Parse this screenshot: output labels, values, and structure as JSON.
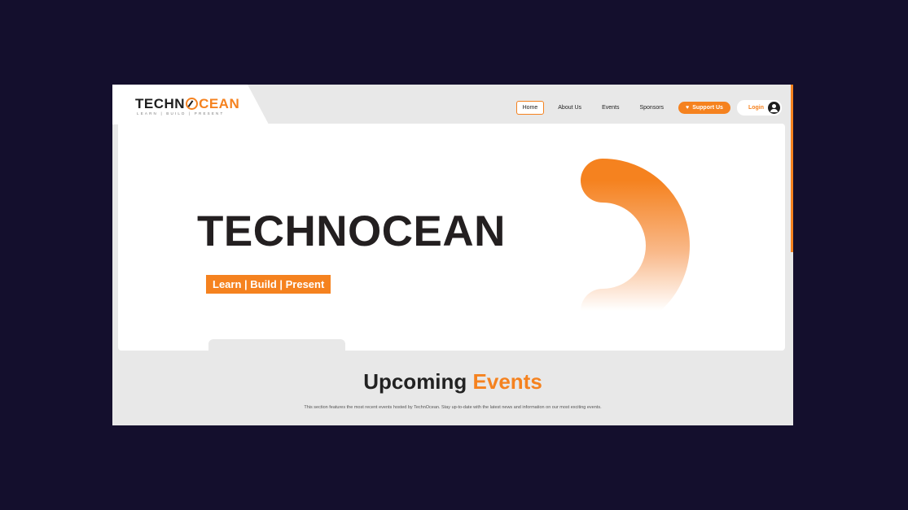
{
  "brand": {
    "logo_part1": "TECHN",
    "logo_part2": "CEAN",
    "logo_icon": "power-o-icon",
    "tagline": "LEARN | BUILD | PRESENT"
  },
  "nav": {
    "items": [
      {
        "label": "Home",
        "active": true
      },
      {
        "label": "About Us",
        "active": false
      },
      {
        "label": "Events",
        "active": false
      },
      {
        "label": "Sponsors",
        "active": false
      }
    ],
    "support_label": "Support Us",
    "support_icon": "heart-icon",
    "login_label": "Login",
    "login_icon": "user-avatar-icon"
  },
  "hero": {
    "title": "TECHNOCEAN",
    "badge": "Learn | Build | Present",
    "decor": "orange-arc-graphic"
  },
  "events": {
    "title_part1": "Upcoming",
    "title_part2": "Events",
    "description": "This section features the most recent events hosted by TechnOcean. Stay up-to-date with the latest news and information on our most exciting events."
  },
  "colors": {
    "accent": "#f5821f",
    "background": "#140f2d",
    "panel": "#e8e8e8",
    "text_dark": "#231f20"
  }
}
